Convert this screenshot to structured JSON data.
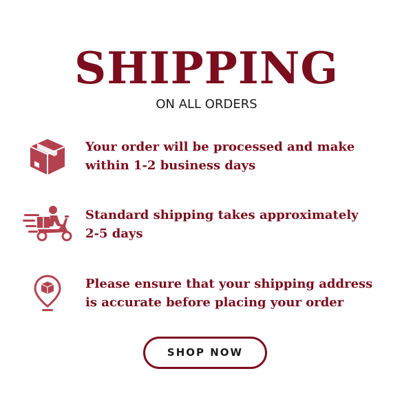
{
  "header": {
    "title": "SHIPPING",
    "subtitle": "ON ALL ORDERS"
  },
  "features": [
    {
      "icon": "package-box-icon",
      "line1": "Your order will be processed and make",
      "line2": "within 1-2 business days"
    },
    {
      "icon": "delivery-scooter-icon",
      "line1": "Standard shipping takes approximately",
      "line2": "2-5 days"
    },
    {
      "icon": "location-pin-package-icon",
      "line1": "Please ensure that your shipping address",
      "line2": "is accurate before placing your order"
    }
  ],
  "cta": {
    "label": "SHOP NOW"
  },
  "colors": {
    "brand": "#7b0d1e",
    "icon": "#b3414f",
    "text": "#1a1a1a"
  }
}
